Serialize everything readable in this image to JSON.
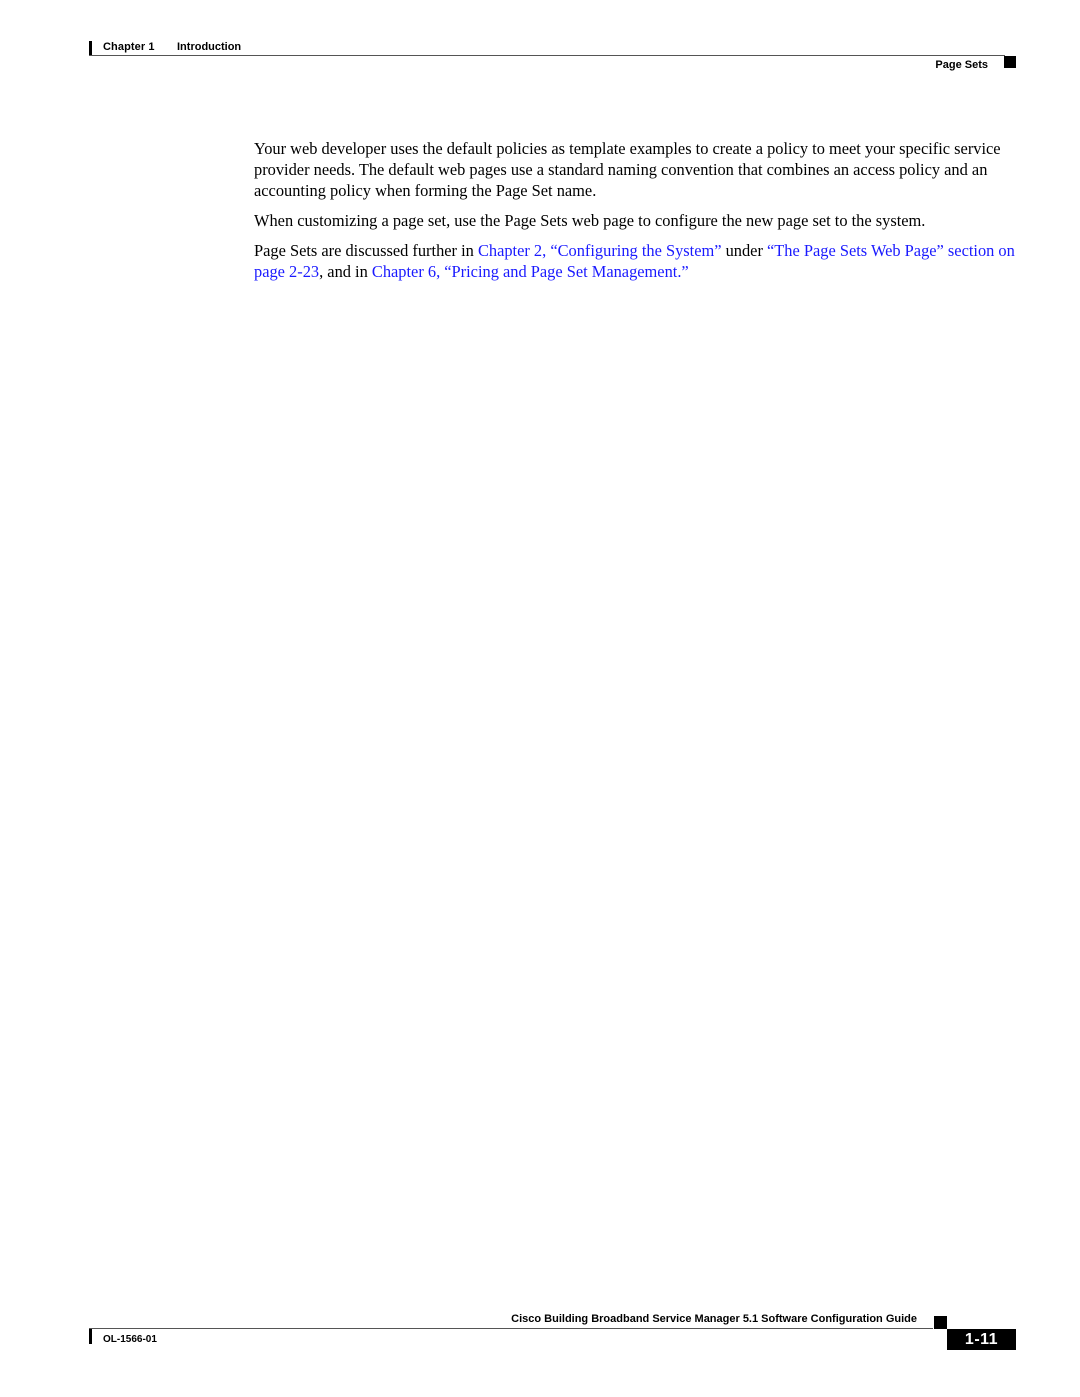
{
  "header": {
    "chapter_label": "Chapter 1",
    "chapter_title": "Introduction",
    "section_title": "Page Sets"
  },
  "body": {
    "paragraphs": [
      {
        "text": "Your web developer uses the default policies as template examples to create a policy to meet your specific service provider needs. The default web pages use a standard naming convention that combines an access policy and an accounting policy when forming the Page Set name."
      },
      {
        "text": "When customizing a page set, use the Page Sets web page to configure the new page set to the system."
      },
      {
        "segments": [
          {
            "text": "Page Sets are discussed further in ",
            "link": false
          },
          {
            "text": "Chapter 2, “Configuring the System”",
            "link": true
          },
          {
            "text": " under ",
            "link": false
          },
          {
            "text": "“The Page Sets Web Page” section on page 2-23",
            "link": true
          },
          {
            "text": ", and in ",
            "link": false
          },
          {
            "text": "Chapter 6, “Pricing and Page Set Management.”",
            "link": true
          }
        ]
      }
    ]
  },
  "footer": {
    "guide_title": "Cisco Building Broadband Service Manager 5.1 Software Configuration Guide",
    "doc_number": "OL-1566-01",
    "page_number": "1-11"
  },
  "colors": {
    "link": "#1a1aff",
    "text": "#000000"
  }
}
